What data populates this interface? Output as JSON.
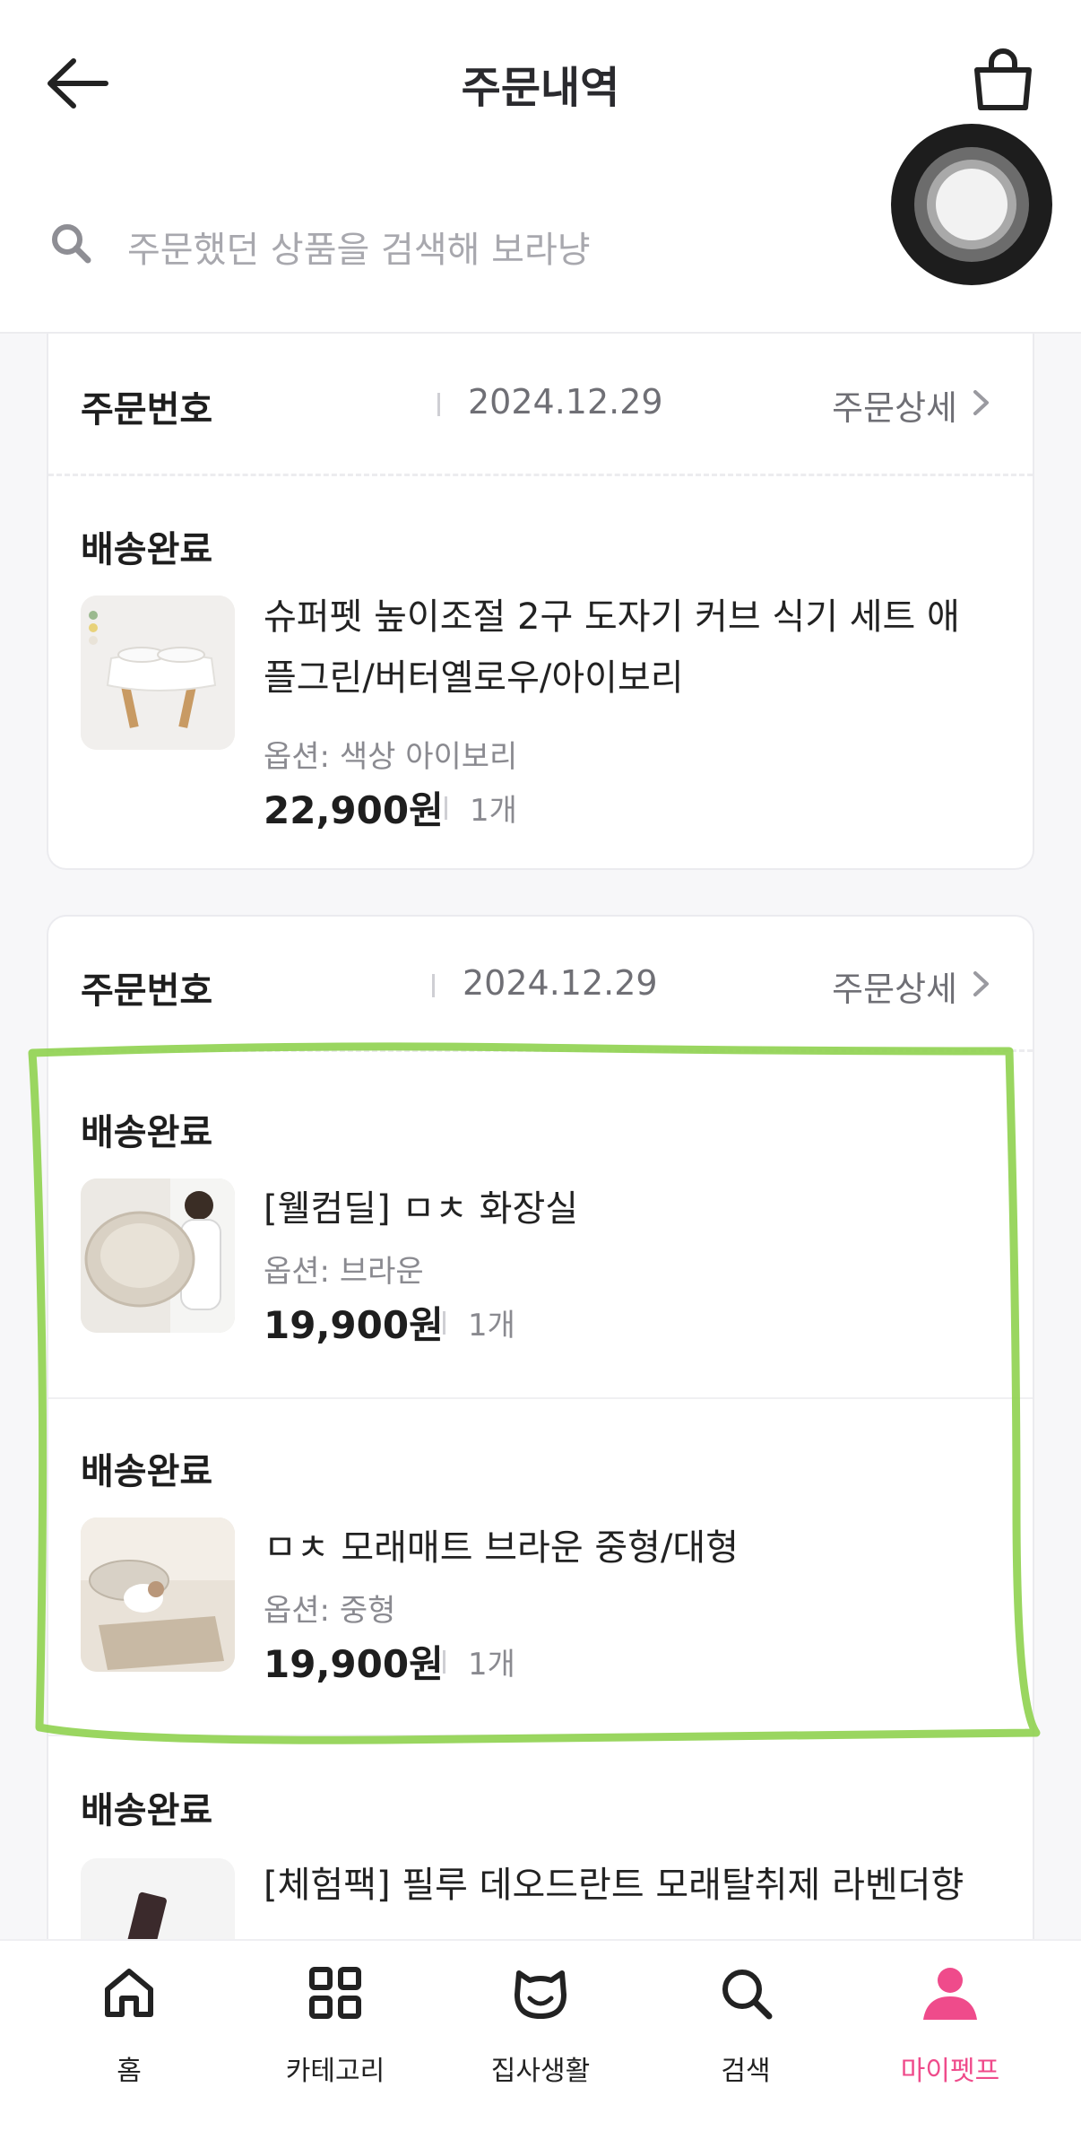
{
  "header": {
    "title": "주문내역",
    "back_icon": "arrow-left-icon",
    "bag_icon": "shopping-bag-icon"
  },
  "search": {
    "placeholder": "주문했던 상품을 검색해 보라냥"
  },
  "orders": [
    {
      "number_label": "주문번호",
      "date": "2024.12.29",
      "detail_label": "주문상세",
      "items": [
        {
          "status": "배송완료",
          "name_line1": "슈퍼펫 높이조절 2구 도자기 커브 식기 세트 애",
          "name_line2": "플그린/버터옐로우/아이보리",
          "option": "옵션: 색상 아이보리",
          "price": "22,900원",
          "qty": "1개"
        }
      ]
    },
    {
      "number_label": "주문번호",
      "date": "2024.12.29",
      "detail_label": "주문상세",
      "items": [
        {
          "status": "배송완료",
          "name_line1": "[웰컴딜] ㅁㅊ 화장실",
          "option": "옵션: 브라운",
          "price": "19,900원",
          "qty": "1개"
        },
        {
          "status": "배송완료",
          "name_line1": "ㅁㅊ 모래매트 브라운 중형/대형",
          "option": "옵션: 중형",
          "price": "19,900원",
          "qty": "1개"
        },
        {
          "status": "배송완료",
          "name_line1": "[체험팩] 필루 데오드란트 모래탈취제 라벤더향"
        }
      ]
    }
  ],
  "tabbar": {
    "items": [
      {
        "label": "홈",
        "icon": "home-icon"
      },
      {
        "label": "카테고리",
        "icon": "grid-icon"
      },
      {
        "label": "집사생활",
        "icon": "cat-face-icon"
      },
      {
        "label": "검색",
        "icon": "search-icon"
      },
      {
        "label": "마이펫프",
        "icon": "person-icon",
        "active": true
      }
    ],
    "active_color": "#ef4b8b"
  },
  "colors": {
    "highlight": "#8fd14f",
    "accent": "#ef4b8b"
  }
}
